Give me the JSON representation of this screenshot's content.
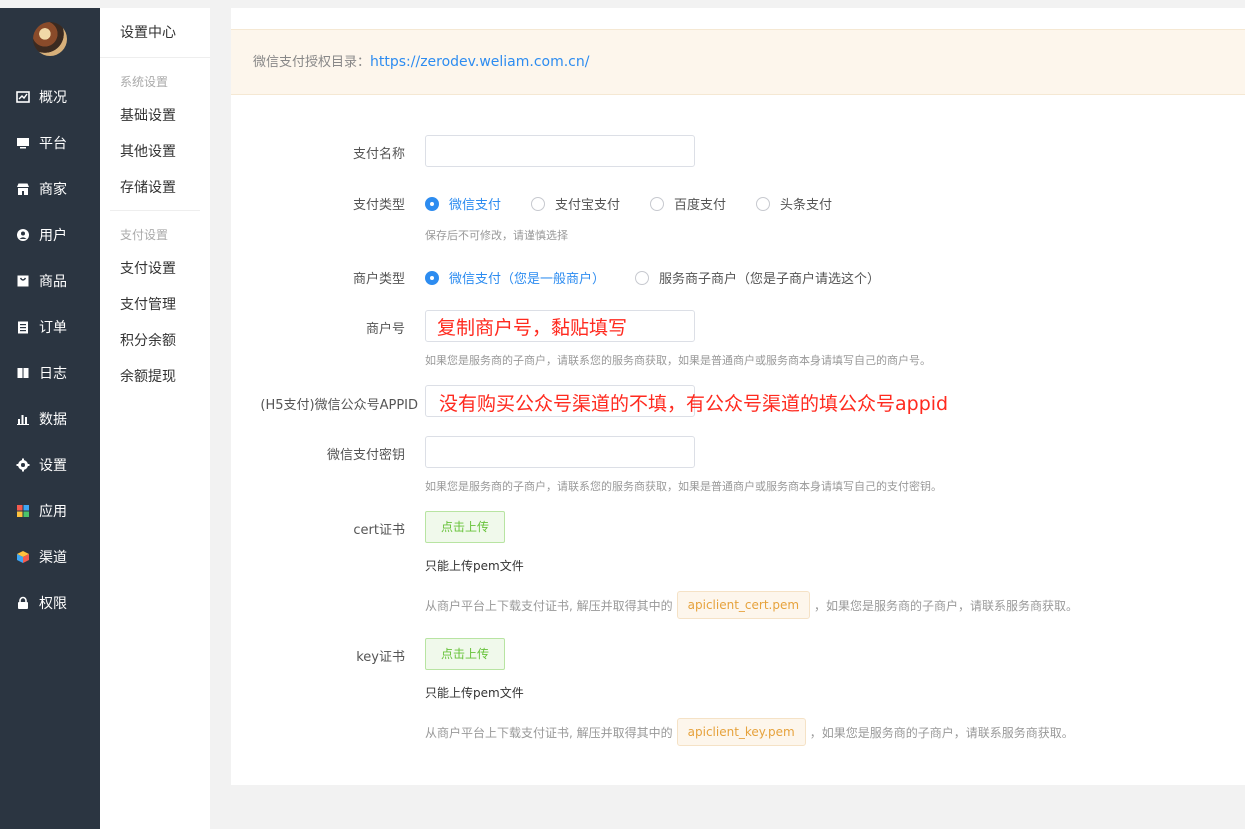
{
  "nav": {
    "items": [
      {
        "label": "概况",
        "icon": "overview-icon"
      },
      {
        "label": "平台",
        "icon": "monitor-icon"
      },
      {
        "label": "商家",
        "icon": "store-icon"
      },
      {
        "label": "用户",
        "icon": "user-icon"
      },
      {
        "label": "商品",
        "icon": "bag-icon"
      },
      {
        "label": "订单",
        "icon": "clipboard-icon"
      },
      {
        "label": "日志",
        "icon": "book-icon"
      },
      {
        "label": "数据",
        "icon": "bar-chart-icon"
      },
      {
        "label": "设置",
        "icon": "gear-icon"
      },
      {
        "label": "应用",
        "icon": "apps-icon"
      },
      {
        "label": "渠道",
        "icon": "cube-icon"
      },
      {
        "label": "权限",
        "icon": "lock-icon"
      }
    ]
  },
  "sidebar": {
    "title": "设置中心",
    "group1": "系统设置",
    "group1_items": [
      "基础设置",
      "其他设置",
      "存储设置"
    ],
    "group2": "支付设置",
    "group2_items": [
      "支付设置",
      "支付管理",
      "积分余额",
      "余额提现"
    ]
  },
  "notice": {
    "label": "微信支付授权目录：",
    "url": "https://zerodev.weliam.com.cn/"
  },
  "form": {
    "pay_name_label": "支付名称",
    "pay_type_label": "支付类型",
    "pay_type_options": [
      "微信支付",
      "支付宝支付",
      "百度支付",
      "头条支付"
    ],
    "pay_type_selected": "微信支付",
    "pay_type_help": "保存后不可修改，请谨慎选择",
    "merchant_type_label": "商户类型",
    "merchant_type_options": [
      "微信支付（您是一般商户）",
      "服务商子商户（您是子商户请选这个）"
    ],
    "merchant_no_label": "商户号",
    "merchant_no_annotation": "复制商户号，黏贴填写",
    "merchant_no_help": "如果您是服务商的子商户，请联系您的服务商获取，如果是普通商户或服务商本身请填写自己的商户号。",
    "appid_label": "(H5支付)微信公众号APPID",
    "appid_annotation": "没有购买公众号渠道的不填，有公众号渠道的填公众号appid",
    "secret_label": "微信支付密钥",
    "secret_help": "如果您是服务商的子商户，请联系您的服务商获取，如果是普通商户或服务商本身请填写自己的支付密钥。",
    "cert_label": "cert证书",
    "upload_label": "点击上传",
    "only_pem": "只能上传pem文件",
    "cert_help_prefix": "从商户平台上下载支付证书, 解压并取得其中的",
    "cert_file": "apiclient_cert.pem",
    "help_suffix": "，如果您是服务商的子商户，请联系服务商获取。",
    "key_label": "key证书",
    "key_file": "apiclient_key.pem"
  },
  "colors": {
    "nav_bg": "#2b3541",
    "primary": "#2d8cf0",
    "annotation": "#ff2a1f",
    "success": "#67c23a",
    "warning": "#e6a23c"
  }
}
